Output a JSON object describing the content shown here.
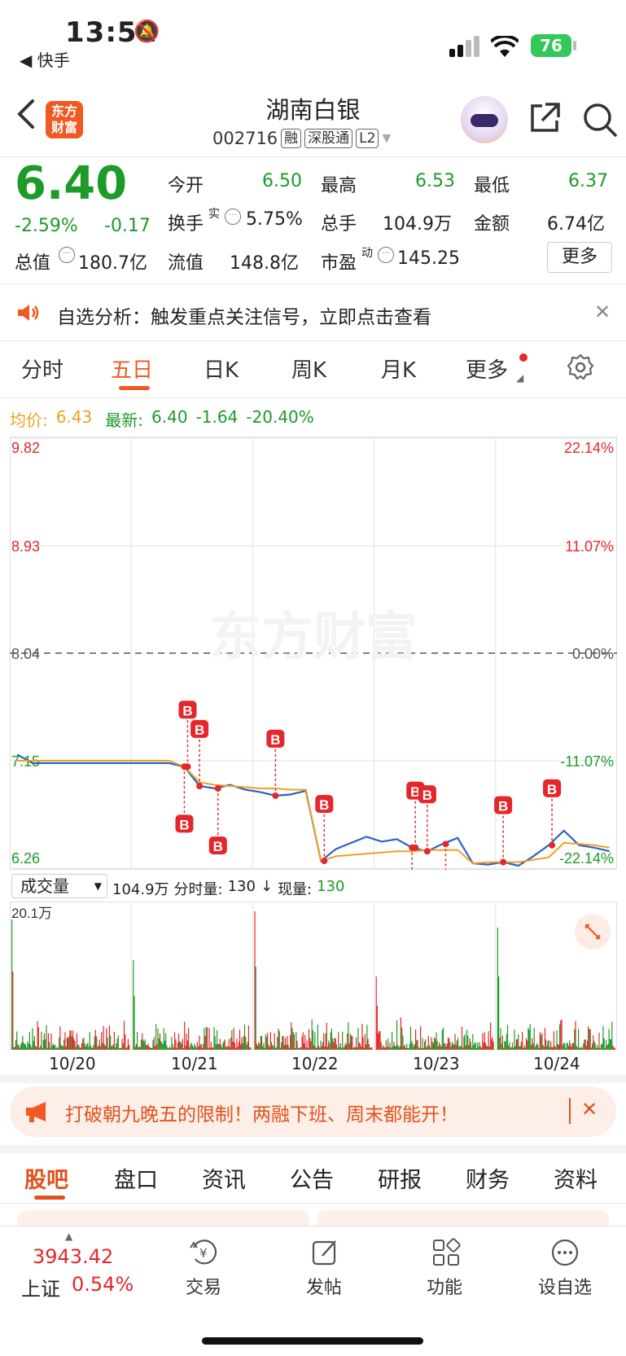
{
  "status": {
    "time": "13:51",
    "back_app": "◀ 快手",
    "battery": "76"
  },
  "header": {
    "title": "湖南白银",
    "code": "002716",
    "tags": [
      "融",
      "深股通",
      "L2"
    ],
    "logo_line1": "东方",
    "logo_line2": "财富"
  },
  "quote": {
    "price": "6.40",
    "change_pct": "-2.59%",
    "change": "-0.17",
    "open_label": "今开",
    "open": "6.50",
    "high_label": "最高",
    "high": "6.53",
    "low_label": "最低",
    "low": "6.37",
    "turnover_label": "换手",
    "turnover_sup": "实",
    "turnover": "5.75%",
    "volume_label": "总手",
    "volume": "104.9万",
    "amount_label": "金额",
    "amount": "6.74亿",
    "mktcap_label": "总值",
    "mktcap": "180.7亿",
    "float_label": "流值",
    "float": "148.8亿",
    "pe_label": "市盈",
    "pe_sup": "动",
    "pe": "145.25",
    "more": "更多"
  },
  "notice": {
    "text": "自选分析：触发重点关注信号，立即点击查看"
  },
  "tabs": [
    "分时",
    "五日",
    "日K",
    "周K",
    "月K",
    "更多"
  ],
  "legend": {
    "avg_label": "均价:",
    "avg": "6.43",
    "latest_label": "最新:",
    "latest": "6.40",
    "chg": "-1.64",
    "chg_pct": "-20.40%"
  },
  "chart_data": {
    "type": "line",
    "title": "",
    "y_ticks_left": [
      "9.82",
      "8.93",
      "8.04",
      "7.15",
      "6.26"
    ],
    "y_ticks_right": [
      "22.14%",
      "11.07%",
      "0.00%",
      "-11.07%",
      "-22.14%"
    ],
    "x_labels": [
      "10/20",
      "10/21",
      "10/22",
      "10/23",
      "10/24"
    ],
    "ylim": [
      6.26,
      9.82
    ],
    "prev_close": 8.04,
    "series": [
      {
        "name": "",
        "color": "#2a62c9",
        "values": [
          7.2,
          7.13,
          7.13,
          7.13,
          7.13,
          7.13,
          7.13,
          7.13,
          7.13,
          7.13,
          7.13,
          7.1,
          6.94,
          6.92,
          6.95,
          6.91,
          6.89,
          6.86,
          6.87,
          6.9,
          6.32,
          6.42,
          6.47,
          6.52,
          6.48,
          6.5,
          6.43,
          6.4,
          6.46,
          6.51,
          6.3,
          6.29,
          6.31,
          6.28,
          6.36,
          6.45,
          6.57,
          6.45,
          6.43,
          6.4
        ]
      },
      {
        "name": "",
        "color": "#f0a020",
        "values": [
          7.15,
          7.15,
          7.15,
          7.15,
          7.15,
          7.15,
          7.15,
          7.15,
          7.15,
          7.15,
          7.15,
          7.1,
          6.97,
          6.95,
          6.94,
          6.93,
          6.92,
          6.92,
          6.91,
          6.91,
          6.32,
          6.36,
          6.37,
          6.38,
          6.39,
          6.4,
          6.4,
          6.41,
          6.41,
          6.41,
          6.3,
          6.31,
          6.31,
          6.31,
          6.33,
          6.35,
          6.47,
          6.46,
          6.45,
          6.43
        ]
      }
    ],
    "volume": {
      "label": "成交量",
      "total": "104.9万",
      "minute_label": "分时量:",
      "minute": "130",
      "now_label": "现量:",
      "now": "130",
      "max_label": "20.1万"
    },
    "buy_markers": [
      "B",
      "B",
      "B",
      "B",
      "B",
      "B",
      "B",
      "B",
      "B",
      "B",
      "B",
      "B"
    ]
  },
  "promo": {
    "text": "打破朝九晚五的限制！两融下班、周末都能开！"
  },
  "bottom_tabs": [
    "股吧",
    "盘口",
    "资讯",
    "公告",
    "研报",
    "财务",
    "资料"
  ],
  "footer": {
    "index_value": "3943.42",
    "index_name": "上证",
    "index_pct": "0.54%",
    "items": [
      "交易",
      "发帖",
      "功能",
      "设自选"
    ]
  },
  "watermark": "东方财富"
}
